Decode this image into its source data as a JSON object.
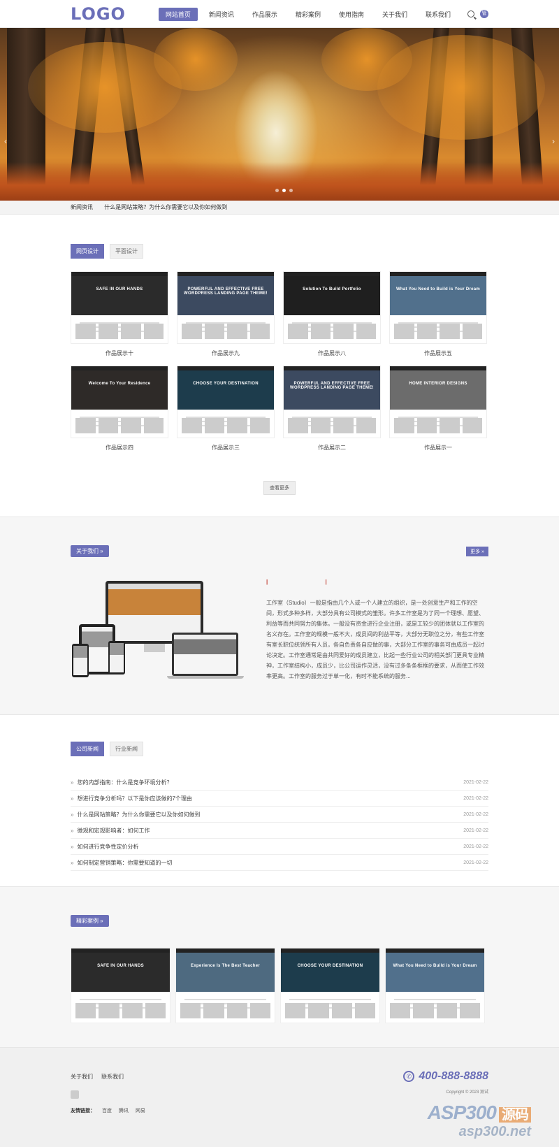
{
  "header": {
    "logo": "LOGO",
    "nav": [
      "网站首页",
      "新闻资讯",
      "作品展示",
      "精彩案例",
      "使用指南",
      "关于我们",
      "联系我们"
    ],
    "active_index": 0,
    "user_icon": "管"
  },
  "banner": {
    "slides": 3,
    "active_slide": 1
  },
  "notice": {
    "label": "新闻资讯",
    "text": "什么是网站策略？为什么你需要它以及你如何做到"
  },
  "works": {
    "tabs": [
      "网页设计",
      "平面设计"
    ],
    "items": [
      {
        "title": "作品展示十",
        "caption": "SAFE IN OUR HANDS",
        "bg": "#2b2b2b"
      },
      {
        "title": "作品展示九",
        "caption": "POWERFUL AND EFFECTIVE FREE WORDPRESS LANDING PAGE THEME!",
        "bg": "#3c4a60"
      },
      {
        "title": "作品展示八",
        "caption": "Solution To Build Portfolio",
        "bg": "#1f1f1f"
      },
      {
        "title": "作品展示五",
        "caption": "What You Need to Build is Your Dream",
        "bg": "#51708c"
      },
      {
        "title": "作品展示四",
        "caption": "Welcome To Your Residence",
        "bg": "#2e2a28"
      },
      {
        "title": "作品展示三",
        "caption": "CHOOSE YOUR DESTINATION",
        "bg": "#1d3c4c"
      },
      {
        "title": "作品展示二",
        "caption": "POWERFUL AND EFFECTIVE FREE WORDPRESS LANDING PAGE THEME!",
        "bg": "#3c4a60"
      },
      {
        "title": "作品展示一",
        "caption": "HOME INTERIOR DESIGNS",
        "bg": "#6c6c6c"
      }
    ],
    "more": "查看更多"
  },
  "about": {
    "title": "关于我们 »",
    "more": "更多 »",
    "mark": "| |",
    "text": "工作室（Studio）一般是指由几个人或一个人建立的组织，是一处创意生产和工作的空间，形式多种多样，大部分具有公司模式的雏形。许多工作室是为了同一个理想、愿望、利益等而共同努力的集体。一般没有资金进行企业注册，或是工较少的团体就以工作室的名义存在。工作室的规模一般不大，成员间的利益平等，大部分无职位之分，有些工作室有室长职位统领所有人员，各自负责各自应做的事，大部分工作室的事务可由成员一起讨论决定。工作室通常是由共同爱好的成员建立，比起一些行业公司的相关部门更具专业精神，工作室结构小，成员少，比公司运作灵活，没有过多条条框框的要求，从而使工作效率更高。工作室的服务过于单一化，有时不能系统的服务..."
  },
  "news": {
    "tabs": [
      "公司新闻",
      "行业新闻"
    ],
    "items": [
      {
        "title": "您的内部指南：什么是竞争环境分析？",
        "date": "2021-02-22"
      },
      {
        "title": "想进行竞争分析吗？以下是你应该做的7个理由",
        "date": "2021-02-22"
      },
      {
        "title": "什么是网站策略？为什么你需要它以及你如何做到",
        "date": "2021-02-22"
      },
      {
        "title": "微观和宏观影响者：如何工作",
        "date": "2021-02-22"
      },
      {
        "title": "如何进行竞争性定价分析",
        "date": "2021-02-22"
      },
      {
        "title": "如何制定营销策略：你需要知道的一切",
        "date": "2021-02-22"
      }
    ]
  },
  "cases": {
    "title": "精彩案例 »",
    "items": [
      {
        "caption": "SAFE IN OUR HANDS",
        "bg": "#2b2b2b"
      },
      {
        "caption": "Experience Is The Best Teacher",
        "bg": "#4e6a80"
      },
      {
        "caption": "CHOOSE YOUR DESTINATION",
        "bg": "#1d3c4c"
      },
      {
        "caption": "What You Need to Build is Your Dream",
        "bg": "#51708c"
      }
    ]
  },
  "footer": {
    "links": [
      "关于我们",
      "联系我们"
    ],
    "friends_label": "友情链接：",
    "friends": [
      "百度",
      "腾讯",
      "网易"
    ],
    "tel": "400-888-8888",
    "copyright": "Copyright © 2023 测试",
    "wm_big": "ASP300",
    "wm_tag": "源码",
    "wm_small": "asp300.net"
  },
  "colors": {
    "accent": "#6b6fb8"
  }
}
